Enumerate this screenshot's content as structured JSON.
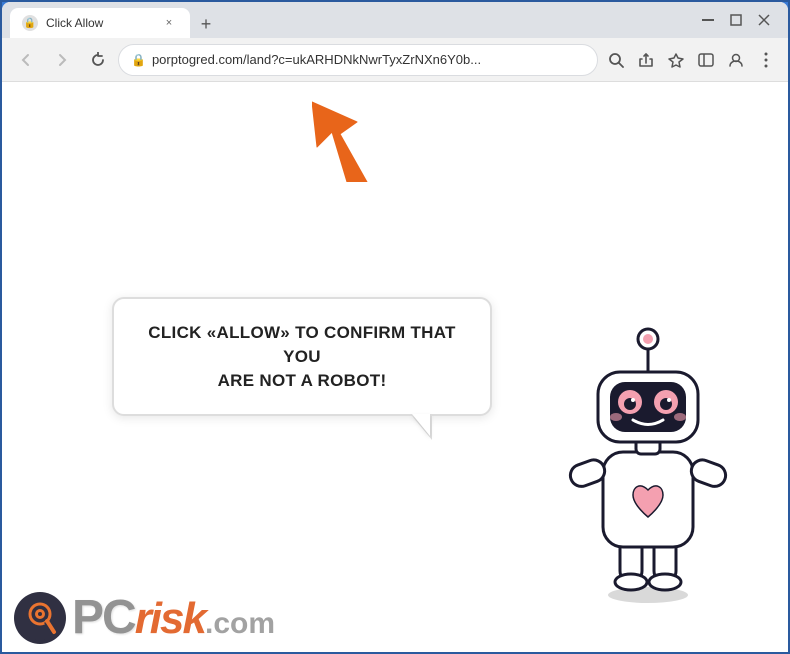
{
  "window": {
    "title": "Click Allow",
    "tab_title": "Click Allow",
    "new_tab_label": "+",
    "close_label": "×",
    "minimize_label": "—",
    "restore_label": "❐",
    "window_close_label": "✕"
  },
  "toolbar": {
    "back_label": "←",
    "forward_label": "→",
    "refresh_label": "↻",
    "url": "porptogred.com/land?c=ukARHDNkNwrTyxZrNXn6Y0b...",
    "search_icon": "🔍",
    "share_icon": "⬆",
    "star_icon": "☆",
    "sidebar_icon": "▣",
    "profile_icon": "👤",
    "menu_icon": "⋮"
  },
  "page": {
    "bubble_text_line1": "CLICK «ALLOW» TO CONFIRM THAT YOU",
    "bubble_text_line2": "ARE NOT A ROBOT!",
    "arrow_color": "#e8651a"
  },
  "watermark": {
    "pc_text": "PC",
    "risk_text": "risk",
    "com_text": ".com"
  }
}
